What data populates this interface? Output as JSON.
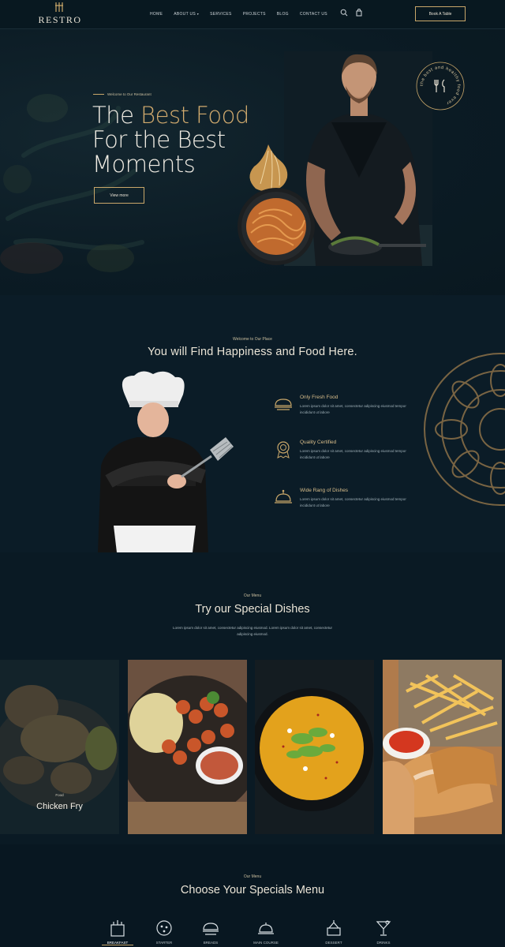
{
  "nav": {
    "logo_text": "RESTRO",
    "items": [
      "HOME",
      "ABOUT US",
      "SERVICES",
      "PROJECTS",
      "BLOG",
      "CONTACT US"
    ],
    "book_label": "Book A Table"
  },
  "hero": {
    "kicker": "Welcome to Our Restaurant",
    "title_line1_a": "The ",
    "title_line1_b": "Best Food",
    "title_line2": "For the Best",
    "title_line3": "Moments",
    "button_label": "View more",
    "stamp_text": "the best and healthy food ever"
  },
  "about": {
    "kicker": "Welcome to Our Place",
    "title": "You will Find Happiness and Food Here.",
    "features": [
      {
        "title": "Only Fresh Food",
        "desc": "Lorem ipsum dolor sit amet, consectetur adipiscing eiusmod tempor incididunt ut labore"
      },
      {
        "title": "Quality Certified",
        "desc": "Lorem ipsum dolor sit amet, consectetur adipiscing eiusmod tempor incididunt ut labore"
      },
      {
        "title": "Wide Rang of Dishes",
        "desc": "Lorem ipsum dolor sit amet, consectetur adipiscing eiusmod tempor incididunt ut labore"
      }
    ]
  },
  "dishes": {
    "kicker": "Our Menu",
    "title": "Try our Special Dishes",
    "desc": "Lorem ipsum dolor sit amet, consectetur adipiscing eiusmod. Lorem ipsum dolor sit amet, consectetur adipiscing eiusmod.",
    "featured_small": "Food",
    "featured_label": "Chicken Fry"
  },
  "specials": {
    "kicker": "Our Menu",
    "title": "Choose Your Specials Menu",
    "categories": [
      "BREAKFAST",
      "STARTER",
      "BREADS",
      "MAIN COURSE",
      "DESSERT",
      "DRINKS"
    ]
  }
}
